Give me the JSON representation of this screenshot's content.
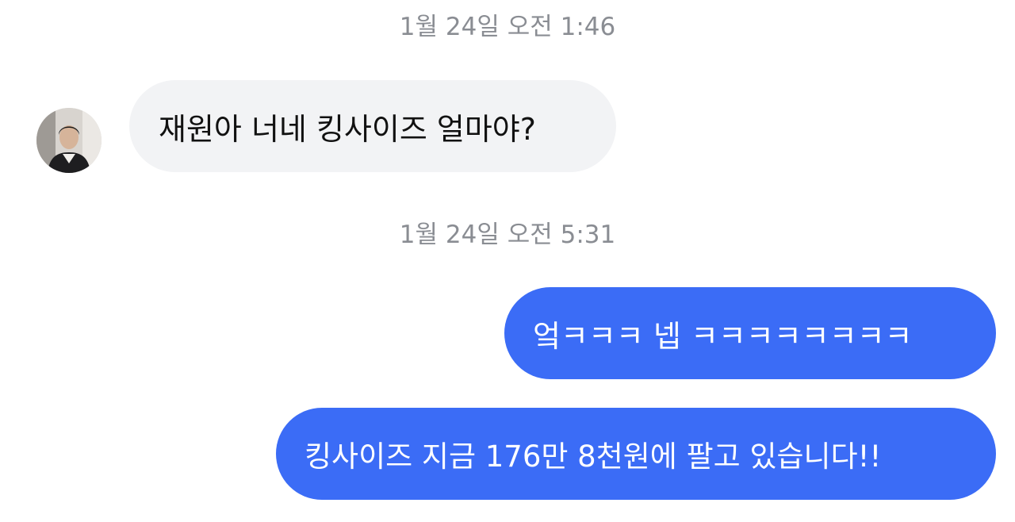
{
  "conversation": {
    "timestamps": [
      "1월 24일 오전 1:46",
      "1월 24일 오전 5:31"
    ],
    "messages": [
      {
        "sender": "other",
        "text": "재원아 너네 킹사이즈 얼마야?"
      },
      {
        "sender": "me",
        "text": "엌ㅋㅋㅋ 넵 ㅋㅋㅋㅋㅋㅋㅋㅋ"
      },
      {
        "sender": "me",
        "text": "킹사이즈 지금 176만 8천원에 팔고 있습니다!!"
      }
    ]
  },
  "colors": {
    "outgoing_bubble": "#3b6cf6",
    "incoming_bubble": "#f2f3f5",
    "timestamp_text": "#8a8d93"
  },
  "icons": {
    "avatar": "profile-photo-avatar"
  }
}
